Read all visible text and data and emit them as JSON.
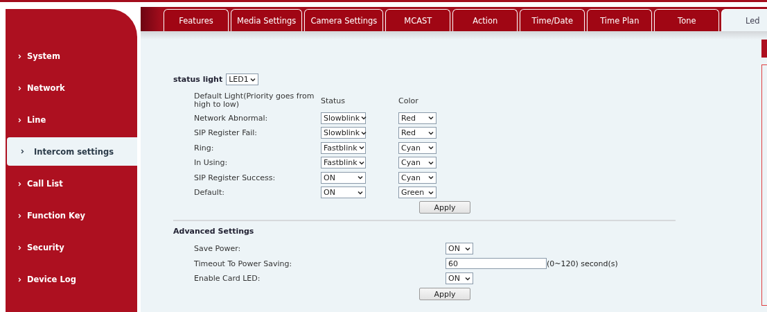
{
  "tabs": [
    {
      "label": "Features",
      "selected": false
    },
    {
      "label": "Media Settings",
      "selected": false
    },
    {
      "label": "Camera Settings",
      "selected": false
    },
    {
      "label": "MCAST",
      "selected": false
    },
    {
      "label": "Action",
      "selected": false
    },
    {
      "label": "Time/Date",
      "selected": false
    },
    {
      "label": "Time Plan",
      "selected": false
    },
    {
      "label": "Tone",
      "selected": false
    },
    {
      "label": "Led",
      "selected": true
    }
  ],
  "sidebar": {
    "items": [
      {
        "label": "System",
        "selected": false
      },
      {
        "label": "Network",
        "selected": false
      },
      {
        "label": "Line",
        "selected": false
      },
      {
        "label": "Intercom settings",
        "selected": true
      },
      {
        "label": "Call List",
        "selected": false
      },
      {
        "label": "Function Key",
        "selected": false
      },
      {
        "label": "Security",
        "selected": false
      },
      {
        "label": "Device Log",
        "selected": false
      }
    ]
  },
  "status_light": {
    "label": "status light",
    "value": "LED1"
  },
  "led_table": {
    "columns": [
      "Default Light(Priority goes from high to low)",
      "Status",
      "Color"
    ],
    "rows": [
      {
        "label": "Network Abnormal:",
        "status": "Slowblink",
        "led_color": "Red"
      },
      {
        "label": "SIP Register Fail:",
        "status": "Slowblink",
        "led_color": "Red"
      },
      {
        "label": "Ring:",
        "status": "Fastblink",
        "led_color": "Cyan"
      },
      {
        "label": "In Using:",
        "status": "Fastblink",
        "led_color": "Cyan"
      },
      {
        "label": "SIP Register Success:",
        "status": "ON",
        "led_color": "Cyan"
      },
      {
        "label": "Default:",
        "status": "ON",
        "led_color": "Green"
      }
    ],
    "apply_button": "Apply"
  },
  "advanced": {
    "title": "Advanced Settings",
    "fields": [
      {
        "kind": "select",
        "label": "Save Power:",
        "value": "ON"
      },
      {
        "kind": "input",
        "label": "Timeout To Power Saving:",
        "value": "60",
        "suffix": "(0~120) second(s)"
      },
      {
        "kind": "select",
        "label": "Enable Card LED:",
        "value": "ON"
      }
    ],
    "apply_button": "Apply"
  }
}
